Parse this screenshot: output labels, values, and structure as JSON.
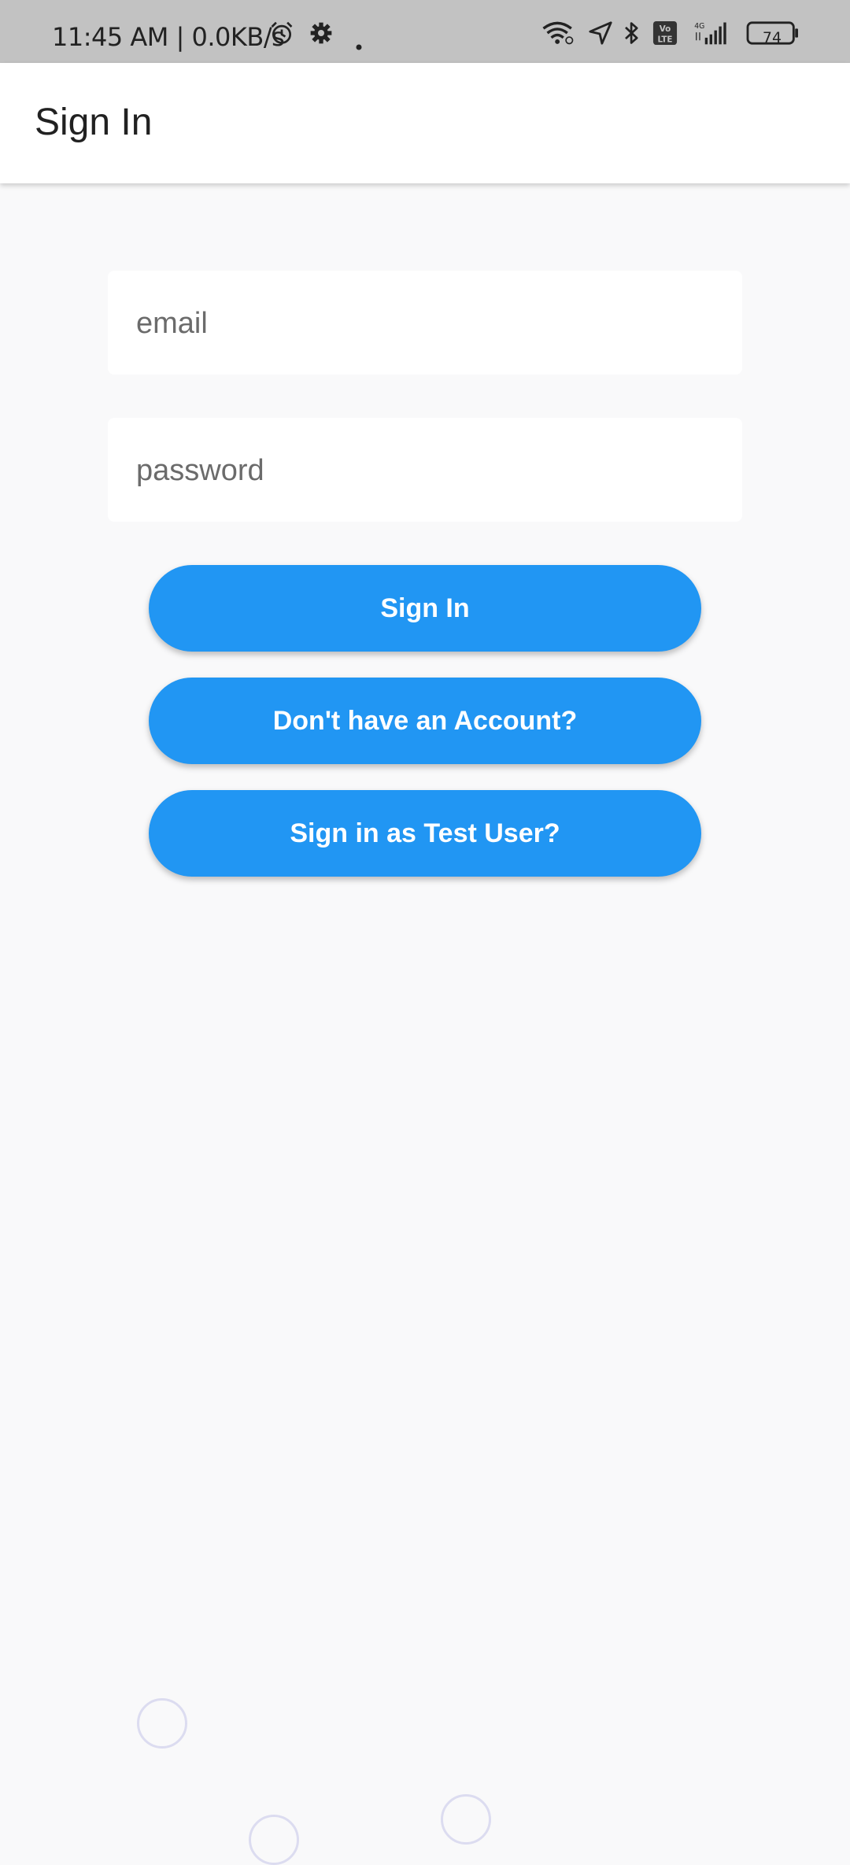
{
  "status_bar": {
    "time": "11:45 AM | 0.0KB/s",
    "battery": "74",
    "icons": [
      "alarm-icon",
      "gear-icon",
      "dot-icon",
      "wifi-icon",
      "location-icon",
      "bluetooth-icon",
      "volte-icon",
      "signal-icon",
      "battery-icon"
    ]
  },
  "app_bar": {
    "title": "Sign In"
  },
  "form": {
    "email_placeholder": "email",
    "password_placeholder": "password"
  },
  "buttons": {
    "sign_in": "Sign In",
    "no_account": "Don't have an Account?",
    "test_user": "Sign in as Test User?"
  },
  "colors": {
    "accent": "#2196f3",
    "background": "#f9f9fa",
    "status_bar": "#c2c2c2"
  }
}
